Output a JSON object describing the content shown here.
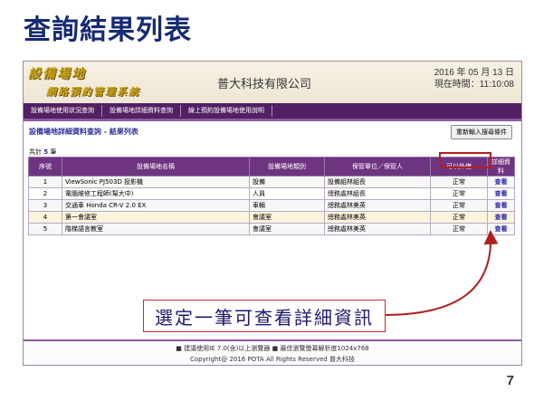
{
  "slide": {
    "title": "查詢結果列表",
    "page_number": "7"
  },
  "header": {
    "logo_line1": "設備場地",
    "logo_line2": "網路預約管理系統",
    "company": "普大科技有限公司",
    "date": "2016 年 05 月 13 日",
    "time": "現在時間：11:10:08"
  },
  "nav": [
    {
      "label": "設備場地使用狀況查詢"
    },
    {
      "label": "設備場地詳細資料查詢"
    },
    {
      "label": "線上預約設備場地使用說明"
    }
  ],
  "main": {
    "heading": "設備場地詳細資料查詢 - 結果列表",
    "reset_label": "重新輸入搜尋條件",
    "count_prefix": "共計",
    "count_value": "5",
    "count_suffix": "筆",
    "columns": [
      "序號",
      "設備場地名稱",
      "設備場地類別",
      "保管單位／保管人",
      "可以外借",
      "詳細資料"
    ],
    "rows": [
      {
        "no": "1",
        "name": "ViewSonic PJ503D 投影機",
        "category": "設備",
        "keeper": "設備組林組長",
        "lendable": "正常",
        "detail": "查看"
      },
      {
        "no": "2",
        "name": "電腦維修工程師(幫大中)",
        "category": "人員",
        "keeper": "總務處林組長",
        "lendable": "正常",
        "detail": "查看"
      },
      {
        "no": "3",
        "name": "交通車 Honda CR-V 2.0 EX",
        "category": "車輛",
        "keeper": "總務處林美英",
        "lendable": "正常",
        "detail": "查看"
      },
      {
        "no": "4",
        "name": "第一會議室",
        "category": "會議室",
        "keeper": "總務處林美英",
        "lendable": "正常",
        "detail": "查看"
      },
      {
        "no": "5",
        "name": "階梯語言教室",
        "category": "會議室",
        "keeper": "總務處林美英",
        "lendable": "正常",
        "detail": "查看"
      }
    ]
  },
  "footer": {
    "line1": "■ 建議使用IE 7.0(含)以上瀏覽器 ■ 最佳瀏覽螢幕解析度1024x768",
    "line2": "Copyright@ 2016 POTA All Rights Reserved 普大科技"
  },
  "callout": {
    "text": "選定一筆可查看詳細資訊"
  },
  "colors": {
    "nav": "#532063",
    "table_header": "#6f3480",
    "title": "#152a73",
    "highlight": "#b02020"
  }
}
